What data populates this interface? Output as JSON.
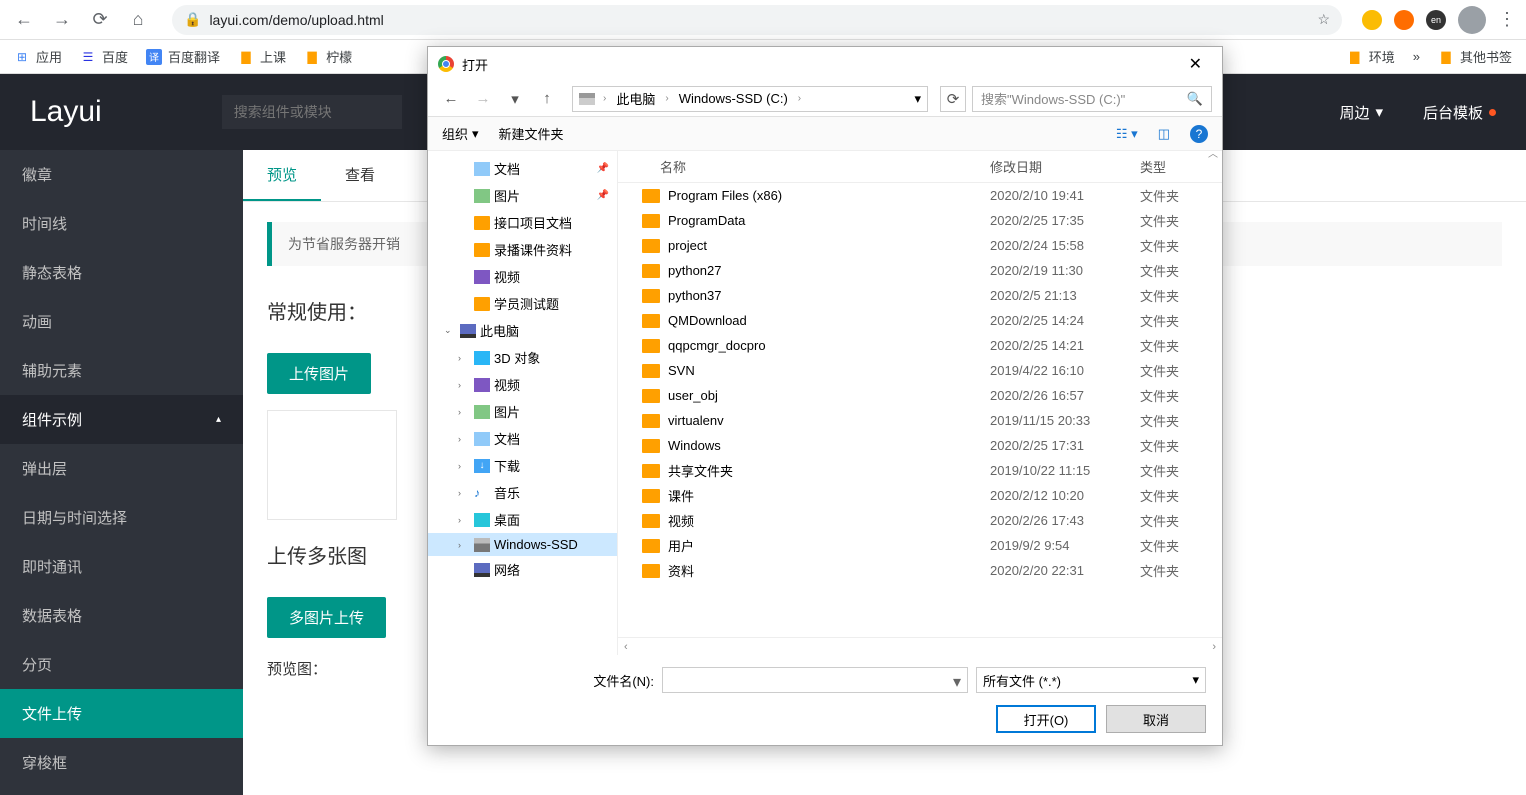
{
  "browser": {
    "url": "layui.com/demo/upload.html",
    "ext_badge": "en"
  },
  "bookmarks": {
    "apps": "应用",
    "baidu": "百度",
    "trans": "百度翻译",
    "class": "上课",
    "lemon": "柠檬",
    "env": "环境",
    "more": "»",
    "other": "其他书签"
  },
  "header": {
    "logo": "Layui",
    "search_ph": "搜索组件或模块",
    "menu1": "周边",
    "menu2": "后台模板"
  },
  "sidebar": {
    "items": [
      "徽章",
      "时间线",
      "静态表格",
      "动画",
      "辅助元素",
      "组件示例",
      "弹出层",
      "日期与时间选择",
      "即时通讯",
      "数据表格",
      "分页",
      "文件上传",
      "穿梭框"
    ]
  },
  "content": {
    "tab1": "预览",
    "tab2": "查看",
    "alert": "为节省服务器开销",
    "sec1": "常规使用：",
    "btn1": "上传图片",
    "sec2": "上传多张图",
    "btn2": "多图片上传",
    "preview": "预览图："
  },
  "dialog": {
    "title": "打开",
    "path1": "此电脑",
    "path2": "Windows-SSD (C:)",
    "search_ph": "搜索\"Windows-SSD (C:)\"",
    "organize": "组织",
    "newfolder": "新建文件夹",
    "col_name": "名称",
    "col_date": "修改日期",
    "col_type": "类型",
    "tree": [
      {
        "label": "文档",
        "icon": "ti-doc",
        "indent": 1,
        "pin": true
      },
      {
        "label": "图片",
        "icon": "ti-img",
        "indent": 1,
        "pin": true
      },
      {
        "label": "接口项目文档",
        "icon": "ti-folder",
        "indent": 1
      },
      {
        "label": "录播课件资料",
        "icon": "ti-folder",
        "indent": 1
      },
      {
        "label": "视频",
        "icon": "ti-video",
        "indent": 1
      },
      {
        "label": "学员测试题",
        "icon": "ti-folder",
        "indent": 1
      },
      {
        "label": "此电脑",
        "icon": "ti-pc",
        "indent": 0,
        "expand": "down"
      },
      {
        "label": "3D 对象",
        "icon": "ti-3d",
        "indent": 1,
        "expand": "right"
      },
      {
        "label": "视频",
        "icon": "ti-video",
        "indent": 1,
        "expand": "right"
      },
      {
        "label": "图片",
        "icon": "ti-img",
        "indent": 1,
        "expand": "right"
      },
      {
        "label": "文档",
        "icon": "ti-doc",
        "indent": 1,
        "expand": "right"
      },
      {
        "label": "下载",
        "icon": "ti-down",
        "indent": 1,
        "expand": "right"
      },
      {
        "label": "音乐",
        "icon": "ti-music",
        "indent": 1,
        "expand": "right"
      },
      {
        "label": "桌面",
        "icon": "ti-desk",
        "indent": 1,
        "expand": "right"
      },
      {
        "label": "Windows-SSD",
        "icon": "ti-disk",
        "indent": 1,
        "expand": "right",
        "selected": true
      },
      {
        "label": "网络",
        "icon": "ti-pc",
        "indent": 1
      }
    ],
    "files": [
      {
        "name": "Program Files (x86)",
        "date": "2020/2/10 19:41",
        "type": "文件夹"
      },
      {
        "name": "ProgramData",
        "date": "2020/2/25 17:35",
        "type": "文件夹"
      },
      {
        "name": "project",
        "date": "2020/2/24 15:58",
        "type": "文件夹"
      },
      {
        "name": "python27",
        "date": "2020/2/19 11:30",
        "type": "文件夹"
      },
      {
        "name": "python37",
        "date": "2020/2/5 21:13",
        "type": "文件夹"
      },
      {
        "name": "QMDownload",
        "date": "2020/2/25 14:24",
        "type": "文件夹"
      },
      {
        "name": "qqpcmgr_docpro",
        "date": "2020/2/25 14:21",
        "type": "文件夹"
      },
      {
        "name": "SVN",
        "date": "2019/4/22 16:10",
        "type": "文件夹"
      },
      {
        "name": "user_obj",
        "date": "2020/2/26 16:57",
        "type": "文件夹"
      },
      {
        "name": "virtualenv",
        "date": "2019/11/15 20:33",
        "type": "文件夹"
      },
      {
        "name": "Windows",
        "date": "2020/2/25 17:31",
        "type": "文件夹"
      },
      {
        "name": "共享文件夹",
        "date": "2019/10/22 11:15",
        "type": "文件夹"
      },
      {
        "name": "课件",
        "date": "2020/2/12 10:20",
        "type": "文件夹"
      },
      {
        "name": "视频",
        "date": "2020/2/26 17:43",
        "type": "文件夹"
      },
      {
        "name": "用户",
        "date": "2019/9/2 9:54",
        "type": "文件夹"
      },
      {
        "name": "资料",
        "date": "2020/2/20 22:31",
        "type": "文件夹"
      }
    ],
    "fn_label": "文件名(N):",
    "filter": "所有文件 (*.*)",
    "open": "打开(O)",
    "cancel": "取消"
  }
}
